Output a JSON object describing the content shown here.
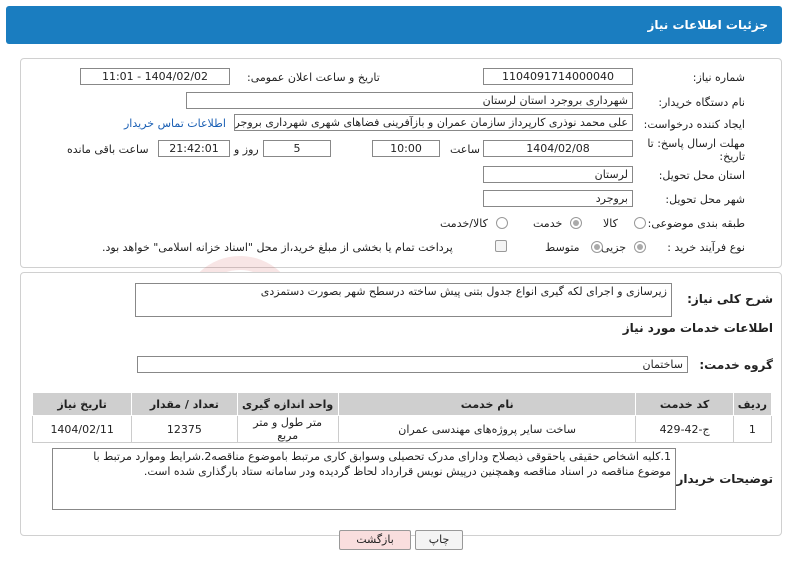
{
  "header": {
    "title": "جزئیات اطلاعات نیاز"
  },
  "form": {
    "need_number_label": "شماره نیاز:",
    "need_number": "1104091714000040",
    "announce_label": "تاریخ و ساعت اعلان عمومی:",
    "announce_value": "1404/02/02 - 11:01",
    "buyer_org_label": "نام دستگاه خریدار:",
    "buyer_org": "شهرداری بروجرد استان لرستان",
    "creator_label": "ایجاد کننده درخواست:",
    "creator": "علی محمد نوذری کارپرداز سازمان عمران و بازآفرینی فضاهای شهری شهرداری بروجرد",
    "contact_link": "اطلاعات تماس خریدار",
    "deadline_label": "مهلت ارسال پاسخ: تا تاریخ:",
    "deadline_date": "1404/02/08",
    "time_label": "ساعت",
    "deadline_time": "10:00",
    "days_value": "5",
    "days_label": "روز و",
    "remaining_time": "21:42:01",
    "remaining_label": "ساعت باقی مانده",
    "province_label": "استان محل تحویل:",
    "province": "لرستان",
    "city_label": "شهر محل تحویل:",
    "city": "بروجرد",
    "category_label": "طبقه بندی موضوعی:",
    "category_options": [
      "کالا",
      "خدمت",
      "کالا/خدمت"
    ],
    "category_selected": "خدمت",
    "process_label": "نوع فرآیند خرید :",
    "process_options": [
      "جزیی",
      "متوسط"
    ],
    "process_selected": "جزیی",
    "payment_note": "پرداخت تمام یا بخشی از مبلغ خرید،از محل \"اسناد خزانه اسلامی\" خواهد بود."
  },
  "summary": {
    "label": "شرح کلی نیاز:",
    "text": "زیرسازی و اجرای لکه گیری انواع جدول بتنی پیش ساخته درسطح شهر بصورت دستمزدی"
  },
  "services": {
    "section_title": "اطلاعات خدمات مورد نیاز",
    "group_label": "گروه خدمت:",
    "group_value": "ساختمان",
    "table_headers": [
      "ردیف",
      "کد خدمت",
      "نام خدمت",
      "واحد اندازه گیری",
      "تعداد / مقدار",
      "تاریخ نیاز"
    ],
    "rows": [
      {
        "row": "1",
        "code": "ج-42-429",
        "name": "ساخت سایر پروژه‌های مهندسی عمران",
        "unit": "متر طول و متر مربع",
        "qty": "12375",
        "date": "1404/02/11"
      }
    ]
  },
  "buyer_notes": {
    "label": "توضیحات خریدار:",
    "text": "1.کلیه اشخاص حقیقی یاحقوقی ذیصلاح ودارای مدرک تحصیلی وسوابق کاری مرتبط باموضوع مناقصه2.شرایط وموارد مرتبط با موضوع مناقصه در اسناد مناقصه وهمچنین درپیش نویس قرارداد لحاظ گردیده ودر سامانه ستاد بارگذاری شده است."
  },
  "buttons": {
    "print": "چاپ",
    "back": "بازگشت"
  },
  "watermark": {
    "text": "AriaTender.neT"
  },
  "colors": {
    "header": "#1a7dc0",
    "back_button": "#f9dede",
    "link": "#1a5fb4"
  }
}
